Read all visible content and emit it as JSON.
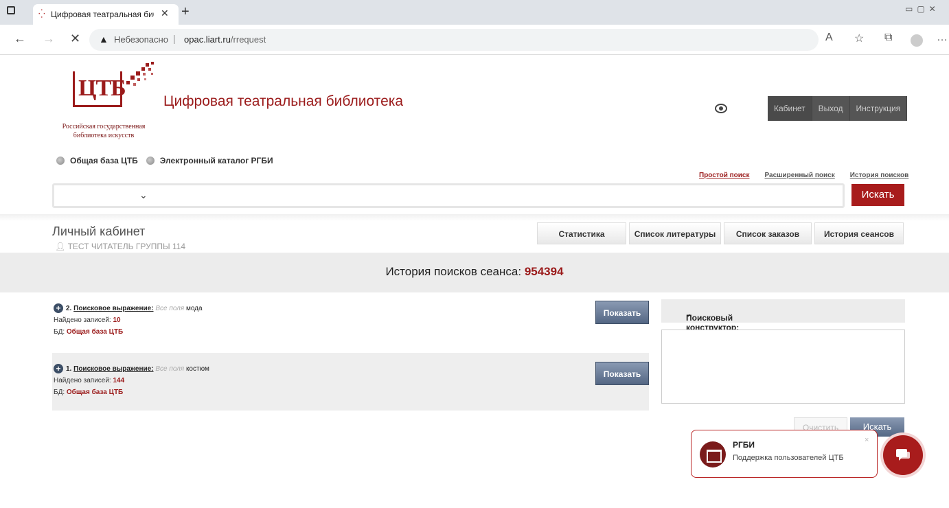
{
  "browser": {
    "tab_title": "Цифровая театральная библиотека",
    "insecure_label": "Небезопасно",
    "url_host": "opac.liart.ru",
    "url_path": "/rrequest"
  },
  "header": {
    "logo_text": "ЦТБ",
    "logo_caption": "Российская государственная библиотека искусств",
    "site_title": "Цифровая театральная библиотека",
    "nav": [
      "Кабинет",
      "Выход",
      "Инструкция"
    ]
  },
  "search": {
    "sources": [
      "Общая база ЦТБ",
      "Электронный каталог РГБИ"
    ],
    "links": {
      "simple": "Простой поиск",
      "advanced": "Расширенный поиск",
      "history": "История поисков"
    },
    "button_label": "Искать"
  },
  "cabinet": {
    "title": "Личный кабинет",
    "user": "ТЕСТ ЧИТАТЕЛЬ ГРУППЫ 114",
    "tabs": [
      "Статистика",
      "Список литературы",
      "Список заказов",
      "История сеансов"
    ]
  },
  "history": {
    "heading": "История поисков сеанса:",
    "session_id": "954394",
    "show_label": "Показать",
    "entries": [
      {
        "num": "2.",
        "label": "Поисковое выражение:",
        "field": "Все поля",
        "query": "мода",
        "found_label": "Найдено записей:",
        "found": "10",
        "db_label": "БД:",
        "db": "Общая база ЦТБ"
      },
      {
        "num": "1.",
        "label": "Поисковое выражение:",
        "field": "Все поля",
        "query": "костюм",
        "found_label": "Найдено записей:",
        "found": "144",
        "db_label": "БД:",
        "db": "Общая база ЦТБ"
      }
    ]
  },
  "constructor": {
    "title": "Поисковый конструктор:",
    "clear_label": "Очистить",
    "search_label": "Искать"
  },
  "chat": {
    "name": "РГБИ",
    "description": "Поддержка пользователей ЦТБ"
  }
}
